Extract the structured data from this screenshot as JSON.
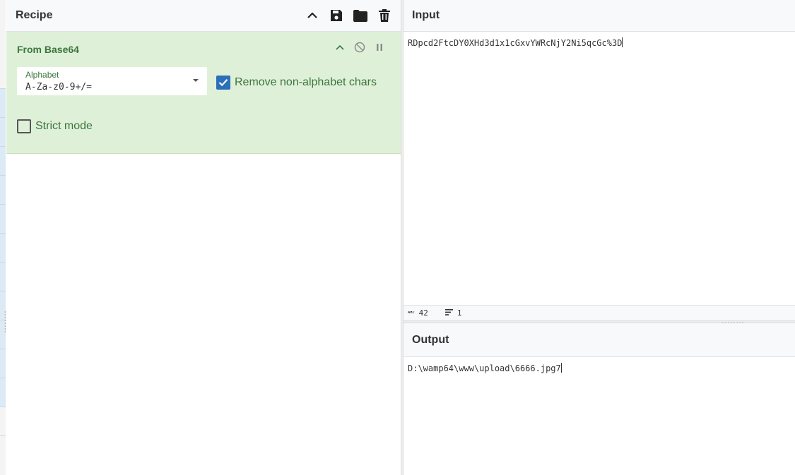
{
  "recipe": {
    "title": "Recipe",
    "icons": [
      "chevron-up-icon",
      "save-icon",
      "folder-icon",
      "trash-icon"
    ],
    "operation": {
      "name": "From Base64",
      "alphabet_label": "Alphabet",
      "alphabet_value": "A-Za-z0-9+/=",
      "remove_non_alphabet_label": "Remove non-alphabet chars",
      "remove_non_alphabet_checked": true,
      "strict_mode_label": "Strict mode",
      "strict_mode_checked": false
    }
  },
  "input": {
    "title": "Input",
    "text": "RDpcd2FtcDY0XHd3d1x1cGxvYWRcNjY2Ni5qcGc%3D",
    "length": "42",
    "lines": "1"
  },
  "output": {
    "title": "Output",
    "text": "D:\\wamp64\\www\\upload\\6666.jpg7"
  },
  "colors": {
    "operation_bg": "#dff0d8",
    "operation_text": "#3c763d",
    "checkbox_on": "#2b6fb8"
  }
}
